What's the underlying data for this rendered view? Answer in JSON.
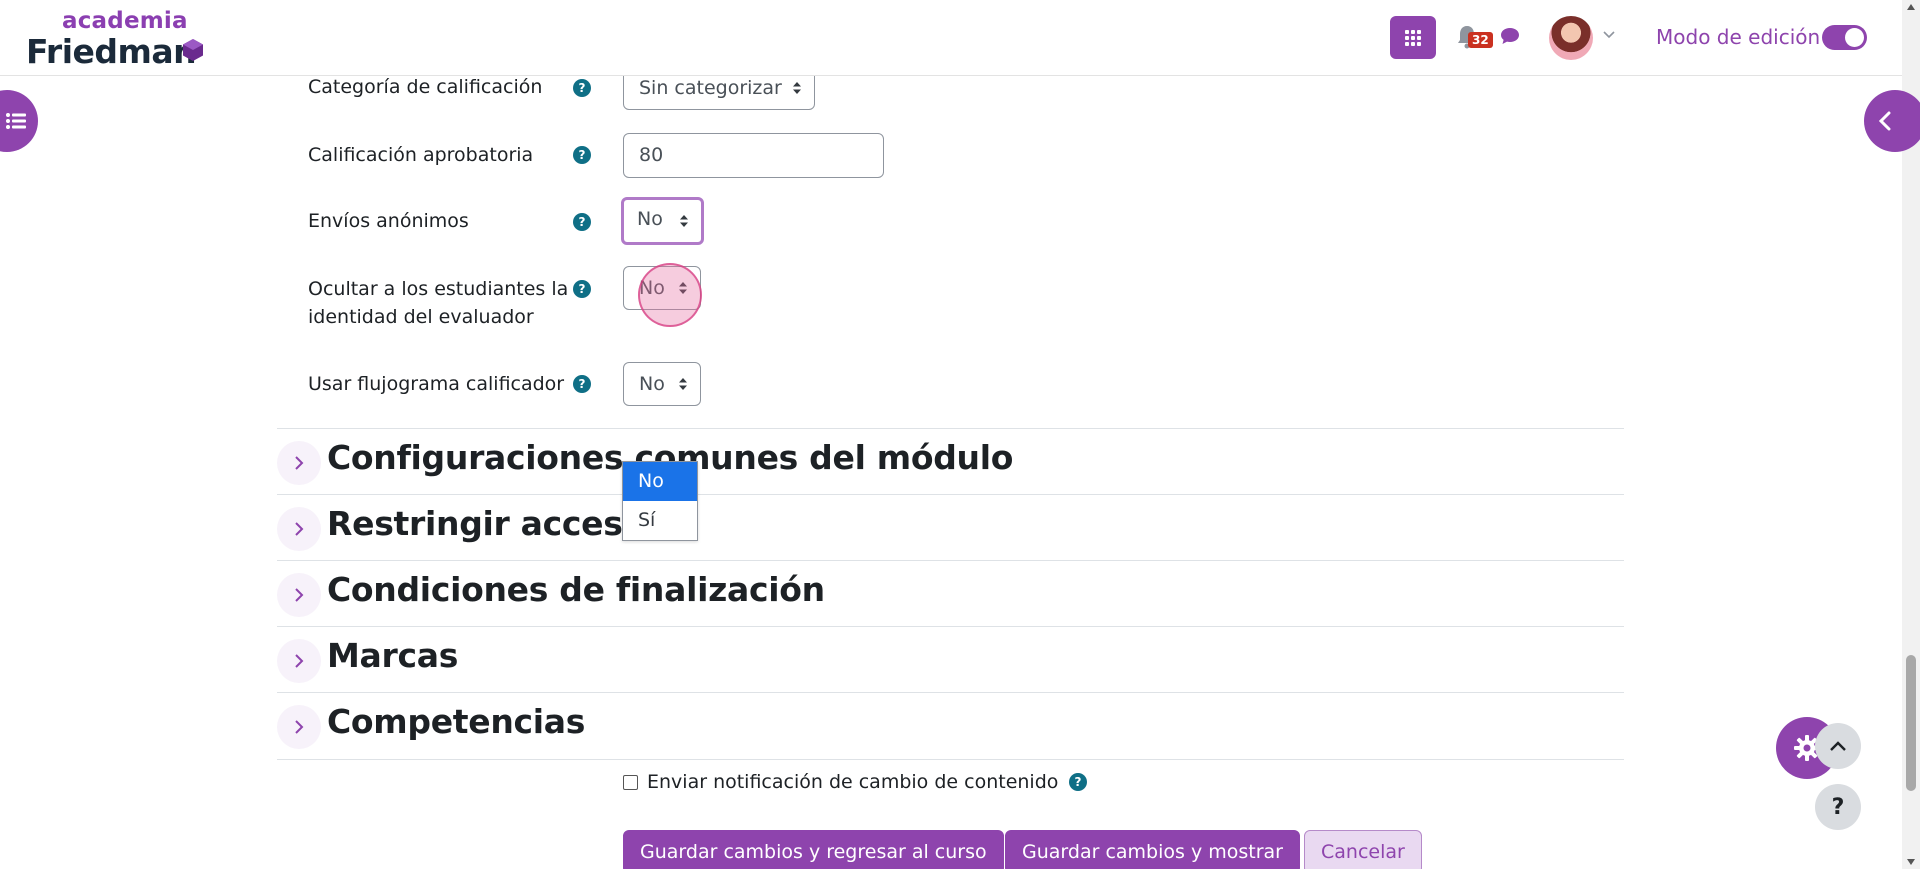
{
  "header": {
    "logo_top": "academia",
    "logo_bottom": "Friedman",
    "notification_count": "32",
    "edit_mode_label": "Modo de edición",
    "edit_mode_on": true
  },
  "form": {
    "grade_category": {
      "label": "Categoría de calificación",
      "value": "Sin categorizar"
    },
    "passing_grade": {
      "label": "Calificación aprobatoria",
      "value": "80"
    },
    "anonymous_submissions": {
      "label": "Envíos anónimos",
      "value": "No"
    },
    "hide_grader": {
      "label_line1": "Ocultar a los estudiantes la",
      "label_line2": "identidad del evaluador",
      "value": "No"
    },
    "marking_workflow": {
      "label": "Usar flujograma calificador",
      "value": "No"
    },
    "help_glyph": "?"
  },
  "dropdown": {
    "options": [
      "No",
      "Sí"
    ],
    "selected": "No"
  },
  "sections": [
    {
      "title": "Configuraciones comunes del módulo"
    },
    {
      "title": "Restringir acceso"
    },
    {
      "title": "Condiciones de finalización"
    },
    {
      "title": "Marcas"
    },
    {
      "title": "Competencias"
    }
  ],
  "footer": {
    "notify_label": "Enviar notificación de cambio de contenido",
    "save_return": "Guardar cambios y regresar al curso",
    "save_display": "Guardar cambios y mostrar",
    "cancel": "Cancelar"
  },
  "floating": {
    "help_glyph": "?"
  },
  "colors": {
    "brand": "#8e44ad",
    "help": "#0f6f86",
    "dropdown_selected": "#1a73e8",
    "badge": "#ca3120"
  }
}
